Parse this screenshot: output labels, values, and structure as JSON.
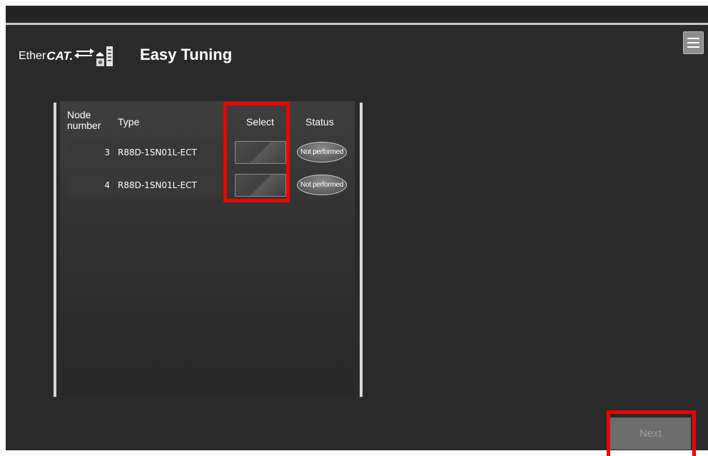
{
  "header": {
    "logo_prefix": "Ether",
    "logo_bold": "CAT.",
    "title": "Easy Tuning"
  },
  "table": {
    "columns": {
      "node_line1": "Node",
      "node_line2": "number",
      "type": "Type",
      "select": "Select",
      "status": "Status"
    },
    "rows": [
      {
        "node": "3",
        "type": "R88D-1SN01L-ECT",
        "status": "Not performed"
      },
      {
        "node": "4",
        "type": "R88D-1SN01L-ECT",
        "status": "Not performed"
      }
    ]
  },
  "footer": {
    "next_label": "Next"
  },
  "colors": {
    "background": "#2a2a2a",
    "highlight": "#ee0000",
    "panel_border": "#d9d9d9"
  },
  "icons": {
    "menu": "hamburger-menu-icon",
    "logo_graphic": "ethercat-connection-icon"
  }
}
